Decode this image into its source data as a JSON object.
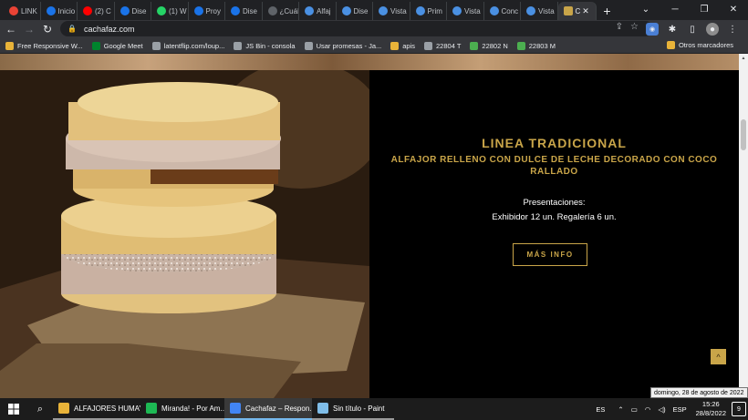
{
  "browser": {
    "tabs": [
      {
        "label": "LINK",
        "icon": "gmail-icon",
        "color": "#ea4335"
      },
      {
        "label": "Inicio",
        "icon": "c-icon",
        "color": "#1a73e8"
      },
      {
        "label": "(2) C",
        "icon": "youtube-icon",
        "color": "#ff0000"
      },
      {
        "label": "Dise",
        "icon": "c-icon",
        "color": "#1a73e8"
      },
      {
        "label": "(1) W",
        "icon": "whatsapp-icon",
        "color": "#25d366"
      },
      {
        "label": "Proy",
        "icon": "c-icon",
        "color": "#1a73e8"
      },
      {
        "label": "Dise",
        "icon": "c-icon",
        "color": "#1a73e8"
      },
      {
        "label": "¿Cuál",
        "icon": "slash-icon",
        "color": "#5f6368"
      },
      {
        "label": "Alfaj",
        "icon": "shield-icon",
        "color": "#4a90e2"
      },
      {
        "label": "Dise",
        "icon": "shield-icon",
        "color": "#4a90e2"
      },
      {
        "label": "Vista",
        "icon": "shield-icon",
        "color": "#4a90e2"
      },
      {
        "label": "Prim",
        "icon": "shield-icon",
        "color": "#4a90e2"
      },
      {
        "label": "Vista",
        "icon": "shield-icon",
        "color": "#4a90e2"
      },
      {
        "label": "Conc",
        "icon": "shield-icon",
        "color": "#4a90e2"
      },
      {
        "label": "Vista",
        "icon": "shield-icon",
        "color": "#4a90e2"
      }
    ],
    "active_tab": {
      "label": "C",
      "icon": "cachafaz-icon",
      "color": "#c9a549"
    },
    "new_tab": "+",
    "url": "cachafaz.com",
    "bookmarks": [
      {
        "label": "Free Responsive W...",
        "color": "#e8b339"
      },
      {
        "label": "Google Meet",
        "color": "#00832d"
      },
      {
        "label": "latentflip.com/loup...",
        "color": "#9aa0a6"
      },
      {
        "label": "JS Bin - consola",
        "color": "#9aa0a6"
      },
      {
        "label": "Usar promesas - Ja...",
        "color": "#9aa0a6"
      },
      {
        "label": "apis",
        "color": "#e8b339"
      },
      {
        "label": "22804 T",
        "color": "#9aa0a6"
      },
      {
        "label": "22802 N",
        "color": "#4caf50"
      },
      {
        "label": "22803 M",
        "color": "#4caf50"
      }
    ],
    "other_bookmarks": "Otros marcadores"
  },
  "page": {
    "title": "LINEA TRADICIONAL",
    "subtitle": "ALFAJOR RELLENO CON DULCE DE LECHE DECORADO CON COCO RALLADO",
    "presentations_label": "Presentaciones:",
    "presentations_value": "Exhibidor 12 un. Regalería 6 un.",
    "more_info": "MÁS INFO",
    "accent_color": "#c9a549"
  },
  "tooltip": "domingo, 28 de agosto de 2022",
  "taskbar": {
    "apps": [
      {
        "label": "ALFAJORES HUMAYA",
        "color": "#e8b339",
        "state": "open"
      },
      {
        "label": "Miranda! - Por Am...",
        "color": "#1db954",
        "state": "open"
      },
      {
        "label": "Cachafaz – Respon...",
        "color": "#4285f4",
        "state": "active"
      },
      {
        "label": "Sin título - Paint",
        "color": "#7fbde8",
        "state": "open"
      }
    ],
    "language": "ESP",
    "ime": "ES",
    "time": "15:26",
    "date": "28/8/2022",
    "notifications": "9"
  }
}
